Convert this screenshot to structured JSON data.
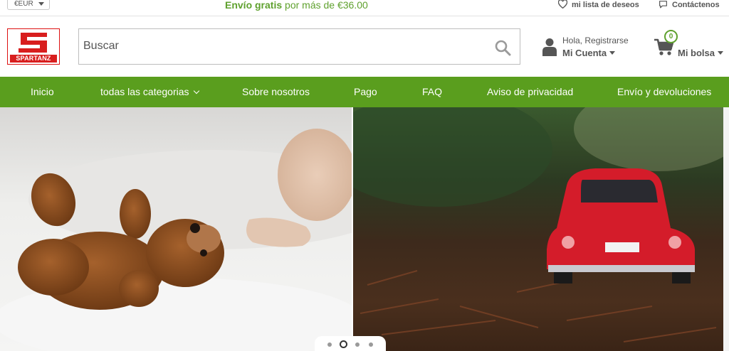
{
  "topbar": {
    "currency": "€EUR",
    "promo_bold": "Envío gratis",
    "promo_rest": "por más de €36.00",
    "wishlist": "mi lista de deseos",
    "contact": "Contáctenos"
  },
  "logo": {
    "wordmark": "SPARTANZ"
  },
  "search": {
    "placeholder": "Buscar"
  },
  "account": {
    "greeting": "Hola, Registrarse",
    "label": "Mi Cuenta"
  },
  "bag": {
    "count": "0",
    "label": "Mi bolsa"
  },
  "nav": {
    "items": [
      {
        "label": "Inicio"
      },
      {
        "label": "todas las categorias"
      },
      {
        "label": "Sobre nosotros"
      },
      {
        "label": "Pago"
      },
      {
        "label": "FAQ"
      },
      {
        "label": "Aviso de privacidad"
      },
      {
        "label": "Envío y devoluciones"
      }
    ]
  },
  "carousel": {
    "slide_count": 4,
    "active_slide": 2
  },
  "colors": {
    "brand_green": "#5a9e1e",
    "promo_green": "#5fa12e",
    "logo_red": "#d81e1e"
  }
}
